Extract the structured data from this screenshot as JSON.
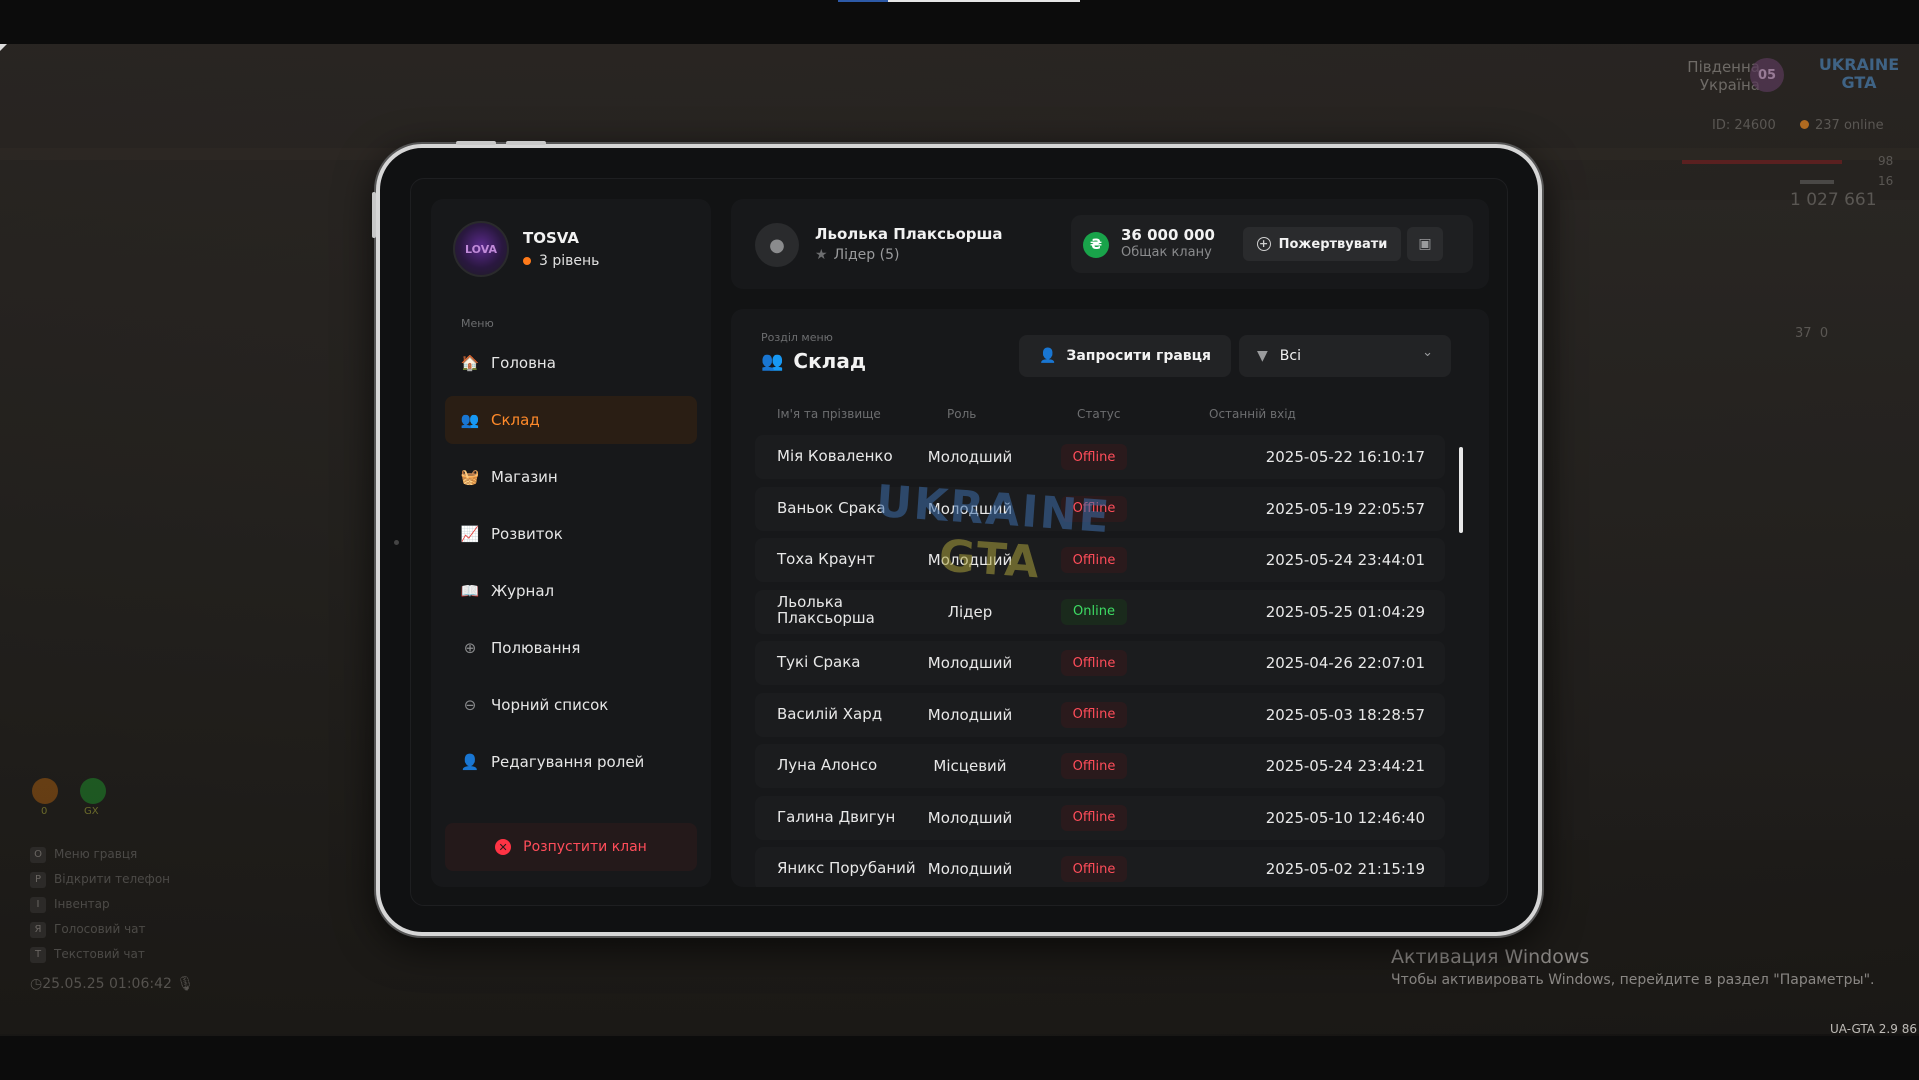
{
  "hud": {
    "region_line1": "Південна",
    "region_line2": "Україна",
    "region_badge": "05",
    "logo_line1": "UKRAINE",
    "logo_line2": "GTA",
    "player_id": "ID: 24600",
    "online": "237 online",
    "health": "98",
    "armor": "16",
    "money": "1 027 661",
    "ammo": "37",
    "ammo_extra": "0",
    "left_icon_a_label": "0",
    "left_icon_b_label": "GX",
    "keys": [
      {
        "key": "O",
        "label": "Меню гравця"
      },
      {
        "key": "P",
        "label": "Відкрити телефон"
      },
      {
        "key": "I",
        "label": "Інвентар"
      },
      {
        "key": "Я",
        "label": "Голосовий чат"
      },
      {
        "key": "T",
        "label": "Текстовий чат"
      }
    ],
    "datetime": "25.05.25 01:06:42"
  },
  "windows": {
    "title": "Активация Windows",
    "subtitle": "Чтобы активировать Windows, перейдите в раздел \"Параметры\".",
    "version": "UA-GTA 2.9   86"
  },
  "clan": {
    "name": "TOSVA",
    "level": "3 рівень",
    "avatar_text": "LOVA"
  },
  "menu": {
    "caption": "Меню",
    "items": [
      {
        "label": "Головна",
        "icon": "🏠"
      },
      {
        "label": "Склад",
        "icon": "👥"
      },
      {
        "label": "Магазин",
        "icon": "🧺"
      },
      {
        "label": "Розвиток",
        "icon": "📈"
      },
      {
        "label": "Журнал",
        "icon": "📖"
      },
      {
        "label": "Полювання",
        "icon": "⊕"
      },
      {
        "label": "Чорний список",
        "icon": "⊖"
      },
      {
        "label": "Редагування ролей",
        "icon": "👤"
      }
    ],
    "disband_label": "Розпустити клан"
  },
  "header": {
    "user_name": "Льолька Плаксьорша",
    "user_role": "Лідер (5)",
    "balance_value": "36 000 000",
    "balance_caption": "Общак клану",
    "donate_label": "Пожертвувати",
    "coin_symbol": "₴"
  },
  "section": {
    "caption": "Розділ меню",
    "title": "Склад",
    "invite_label": "Запросити гравця",
    "filter_value": "Всі"
  },
  "table": {
    "headers": {
      "name": "Ім'я та прізвище",
      "role": "Роль",
      "status": "Статус",
      "last_login": "Останній вхід"
    },
    "rows": [
      {
        "name": "Мія Коваленко",
        "role": "Молодший",
        "status": "Offline",
        "last": "2025-05-22 16:10:17"
      },
      {
        "name": "Ваньок Срака",
        "role": "Молодший",
        "status": "Offline",
        "last": "2025-05-19 22:05:57"
      },
      {
        "name": "Тоха Краунт",
        "role": "Молодший",
        "status": "Offline",
        "last": "2025-05-24 23:44:01"
      },
      {
        "name": "Льолька Плаксьорша",
        "role": "Лідер",
        "status": "Online",
        "last": "2025-05-25 01:04:29"
      },
      {
        "name": "Тукі Срака",
        "role": "Молодший",
        "status": "Offline",
        "last": "2025-04-26 22:07:01"
      },
      {
        "name": "Василій Хард",
        "role": "Молодший",
        "status": "Offline",
        "last": "2025-05-03 18:28:57"
      },
      {
        "name": "Луна Алонсо",
        "role": "Місцевий",
        "status": "Offline",
        "last": "2025-05-24 23:44:21"
      },
      {
        "name": "Галина Двигун",
        "role": "Молодший",
        "status": "Offline",
        "last": "2025-05-10 12:46:40"
      },
      {
        "name": "Яникс Порубаний",
        "role": "Молодший",
        "status": "Offline",
        "last": "2025-05-02 21:15:19"
      }
    ]
  },
  "watermark": {
    "line1": "UKRAINE",
    "line2": "GTA"
  },
  "colors": {
    "accent": "#ff8a2a",
    "offline": "#ff4d5a",
    "online": "#3ddc64",
    "coin": "#19a34a"
  }
}
